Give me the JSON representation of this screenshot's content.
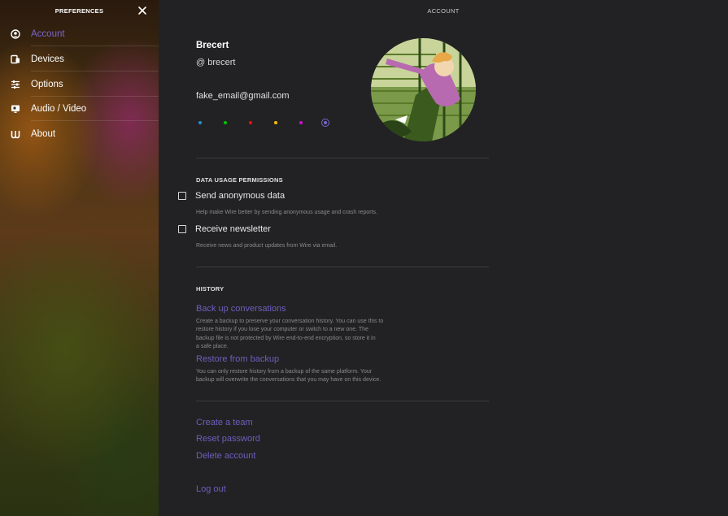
{
  "sidebar": {
    "title": "PREFERENCES",
    "items": [
      {
        "label": "Account",
        "icon": "person-circle-icon",
        "active": true
      },
      {
        "label": "Devices",
        "icon": "devices-icon",
        "active": false
      },
      {
        "label": "Options",
        "icon": "sliders-icon",
        "active": false
      },
      {
        "label": "Audio / Video",
        "icon": "monitor-icon",
        "active": false
      },
      {
        "label": "About",
        "icon": "wire-logo-icon",
        "active": false
      }
    ]
  },
  "main": {
    "title": "ACCOUNT",
    "profile": {
      "name": "Brecert",
      "handle": "@ brecert",
      "email": "fake_email@gmail.com",
      "accent_colors": [
        "#2391d3",
        "#00c800",
        "#fb0807",
        "#febf02",
        "#d50cd8",
        "#7a66cc"
      ],
      "selected_accent": "#7a66cc"
    },
    "data_usage": {
      "title": "DATA USAGE PERMISSIONS",
      "send_anonymous_label": "Send anonymous data",
      "send_anonymous_hint": "Help make Wire better by sending anonymous usage and crash reports.",
      "send_anonymous_checked": false,
      "newsletter_label": "Receive newsletter",
      "newsletter_hint": "Receive news and product updates from Wire via email.",
      "newsletter_checked": false
    },
    "history": {
      "title": "HISTORY",
      "backup_label": "Back up conversations",
      "backup_hint_lines": [
        "Create a backup to preserve your conversation history. You can use this to",
        "restore history if you lose your computer or switch to a new one. The",
        "backup file is not protected by Wire end-to-end encryption, so store it in",
        "a safe place."
      ],
      "restore_label": "Restore from backup",
      "restore_hint_lines": [
        "You can only restore history from a backup of the same platform. Your",
        "backup will overwrite the conversations that you may have on this device."
      ]
    },
    "links": {
      "create_team": "Create a team",
      "reset_password": "Reset password",
      "delete_account": "Delete account",
      "log_out": "Log out"
    }
  }
}
